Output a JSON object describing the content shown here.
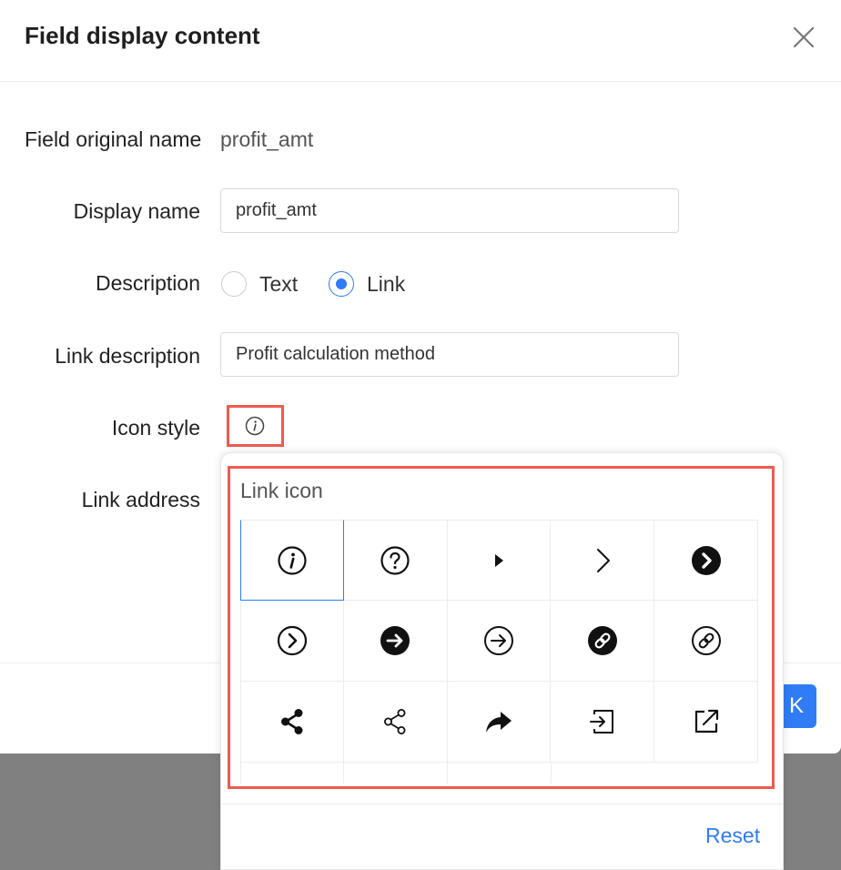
{
  "dialog": {
    "title": "Field display content",
    "close_icon": "close-icon"
  },
  "form": {
    "original_name_label": "Field original name",
    "original_name_value": "profit_amt",
    "display_name_label": "Display name",
    "display_name_value": "profit_amt",
    "description_label": "Description",
    "description_options": [
      {
        "label": "Text",
        "checked": false
      },
      {
        "label": "Link",
        "checked": true
      }
    ],
    "link_description_label": "Link description",
    "link_description_value": "Profit calculation method",
    "icon_style_label": "Icon style",
    "icon_style_current": "info-circle-icon",
    "link_address_label": "Link address"
  },
  "footer": {
    "ok_label": "K"
  },
  "popover": {
    "title": "Link icon",
    "reset_label": "Reset",
    "icons": [
      [
        "info-circle-icon",
        "question-circle-icon",
        "caret-right-icon",
        "chevron-right-icon",
        "chevron-right-filled-icon"
      ],
      [
        "chevron-right-circle-icon",
        "arrow-right-filled-icon",
        "arrow-right-circle-icon",
        "link-filled-icon",
        "link-circle-icon"
      ],
      [
        "share-filled-icon",
        "share-outline-icon",
        "forward-icon",
        "login-icon",
        "external-link-icon"
      ]
    ],
    "selected_icon": "info-circle-icon"
  },
  "colors": {
    "accent": "#2f7cf6",
    "highlight": "#ef5a4f",
    "backdrop": "#808080"
  }
}
